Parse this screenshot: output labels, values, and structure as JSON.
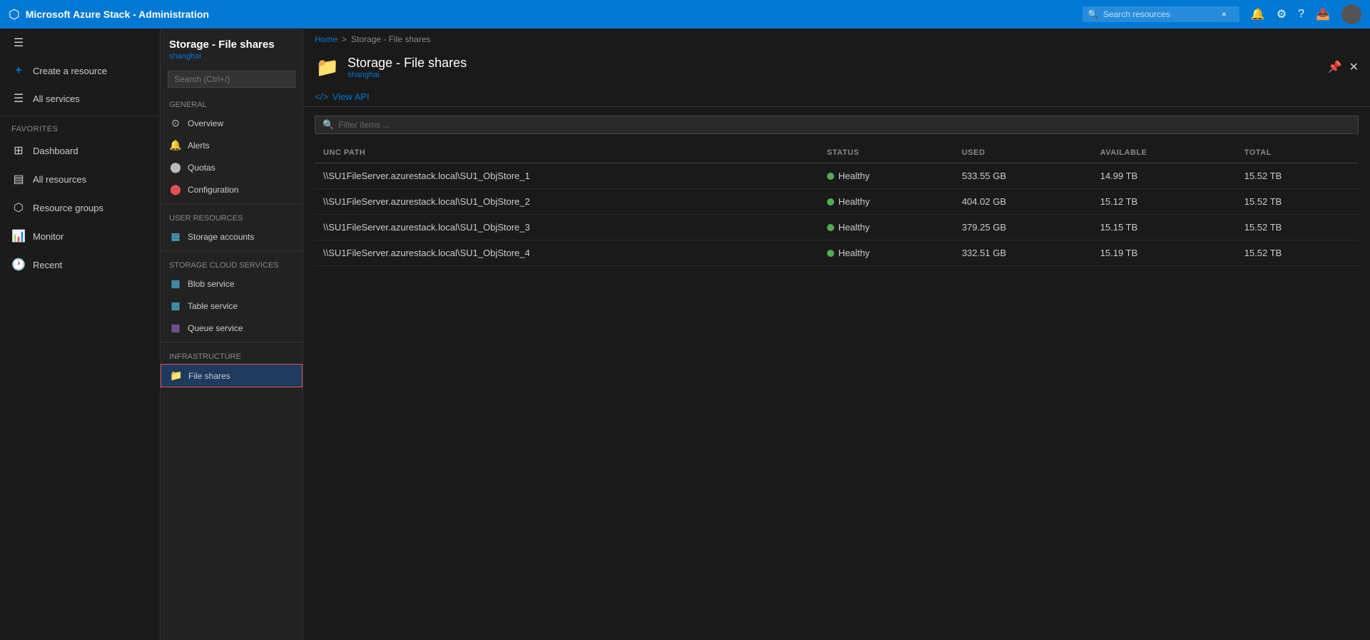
{
  "app": {
    "title": "Microsoft Azure Stack - Administration"
  },
  "topbar": {
    "title": "Microsoft Azure Stack - Administration",
    "search_placeholder": "Search resources",
    "search_close": "×"
  },
  "sidebar": {
    "create_resource": "Create a resource",
    "all_services": "All services",
    "favorites_label": "FAVORITES",
    "items": [
      {
        "label": "Dashboard",
        "icon": "⊞"
      },
      {
        "label": "All resources",
        "icon": "▤"
      },
      {
        "label": "Resource groups",
        "icon": "⬡"
      },
      {
        "label": "Monitor",
        "icon": "📊"
      },
      {
        "label": "Recent",
        "icon": "🕐"
      }
    ]
  },
  "resource_nav": {
    "title": "Storage - File shares",
    "subtitle": "shanghai",
    "search_placeholder": "Search (Ctrl+/)",
    "general_label": "GENERAL",
    "user_resources_label": "USER RESOURCES",
    "storage_cloud_services_label": "STORAGE CLOUD SERVICES",
    "infrastructure_label": "INFRASTRUCTURE",
    "general_items": [
      {
        "label": "Overview",
        "icon": "⊙"
      },
      {
        "label": "Alerts",
        "icon": "🔔"
      },
      {
        "label": "Quotas",
        "icon": "⭕"
      },
      {
        "label": "Configuration",
        "icon": "🔴"
      }
    ],
    "user_resource_items": [
      {
        "label": "Storage accounts",
        "icon": "🟦"
      }
    ],
    "cloud_service_items": [
      {
        "label": "Blob service",
        "icon": "🟦"
      },
      {
        "label": "Table service",
        "icon": "🟦"
      },
      {
        "label": "Queue service",
        "icon": "🟪"
      }
    ],
    "infrastructure_items": [
      {
        "label": "File shares",
        "icon": "📁",
        "active": true
      }
    ]
  },
  "content": {
    "breadcrumb_home": "Home",
    "breadcrumb_separator": ">",
    "breadcrumb_current": "Storage - File shares",
    "title": "Storage - File shares",
    "subtitle": "shanghai",
    "view_api_label": "View API",
    "filter_placeholder": "Filter items ...",
    "columns": {
      "unc_path": "UNC PATH",
      "status": "STATUS",
      "used": "USED",
      "available": "AVAILABLE",
      "total": "TOTAL"
    },
    "rows": [
      {
        "unc_path": "\\\\SU1FileServer.azurestack.local\\SU1_ObjStore_1",
        "status": "Healthy",
        "used": "533.55 GB",
        "available": "14.99 TB",
        "total": "15.52 TB"
      },
      {
        "unc_path": "\\\\SU1FileServer.azurestack.local\\SU1_ObjStore_2",
        "status": "Healthy",
        "used": "404.02 GB",
        "available": "15.12 TB",
        "total": "15.52 TB"
      },
      {
        "unc_path": "\\\\SU1FileServer.azurestack.local\\SU1_ObjStore_3",
        "status": "Healthy",
        "used": "379.25 GB",
        "available": "15.15 TB",
        "total": "15.52 TB"
      },
      {
        "unc_path": "\\\\SU1FileServer.azurestack.local\\SU1_ObjStore_4",
        "status": "Healthy",
        "used": "332.51 GB",
        "available": "15.19 TB",
        "total": "15.52 TB"
      }
    ]
  }
}
